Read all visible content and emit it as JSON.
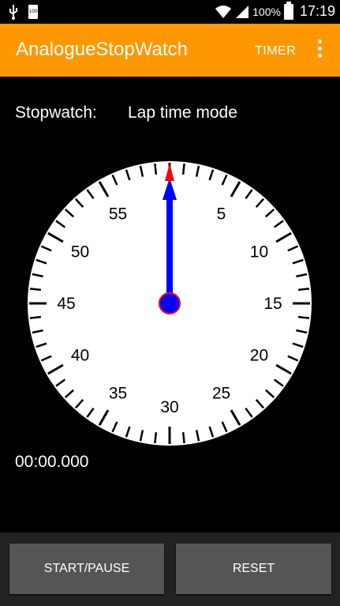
{
  "status_bar": {
    "small_battery_text": "100",
    "battery_percent": "100%",
    "time": "17:19"
  },
  "app_bar": {
    "title": "AnalogueStopWatch",
    "timer_action": "TIMER"
  },
  "mode": {
    "label": "Stopwatch:",
    "value": "Lap time mode"
  },
  "dial": {
    "numbers": [
      "5",
      "10",
      "15",
      "20",
      "25",
      "30",
      "35",
      "40",
      "45",
      "50",
      "55"
    ],
    "hand_seconds": 0,
    "colors": {
      "face": "#ffffff",
      "hand": "#0000ff",
      "pointer_tip": "#ff0000",
      "hub_outline": "#ff0000"
    }
  },
  "elapsed_time": "00:00.000",
  "buttons": {
    "start_pause": "START/PAUSE",
    "reset": "RESET"
  },
  "colors": {
    "accent": "#ff9800",
    "background": "#000000",
    "button": "#555555"
  }
}
